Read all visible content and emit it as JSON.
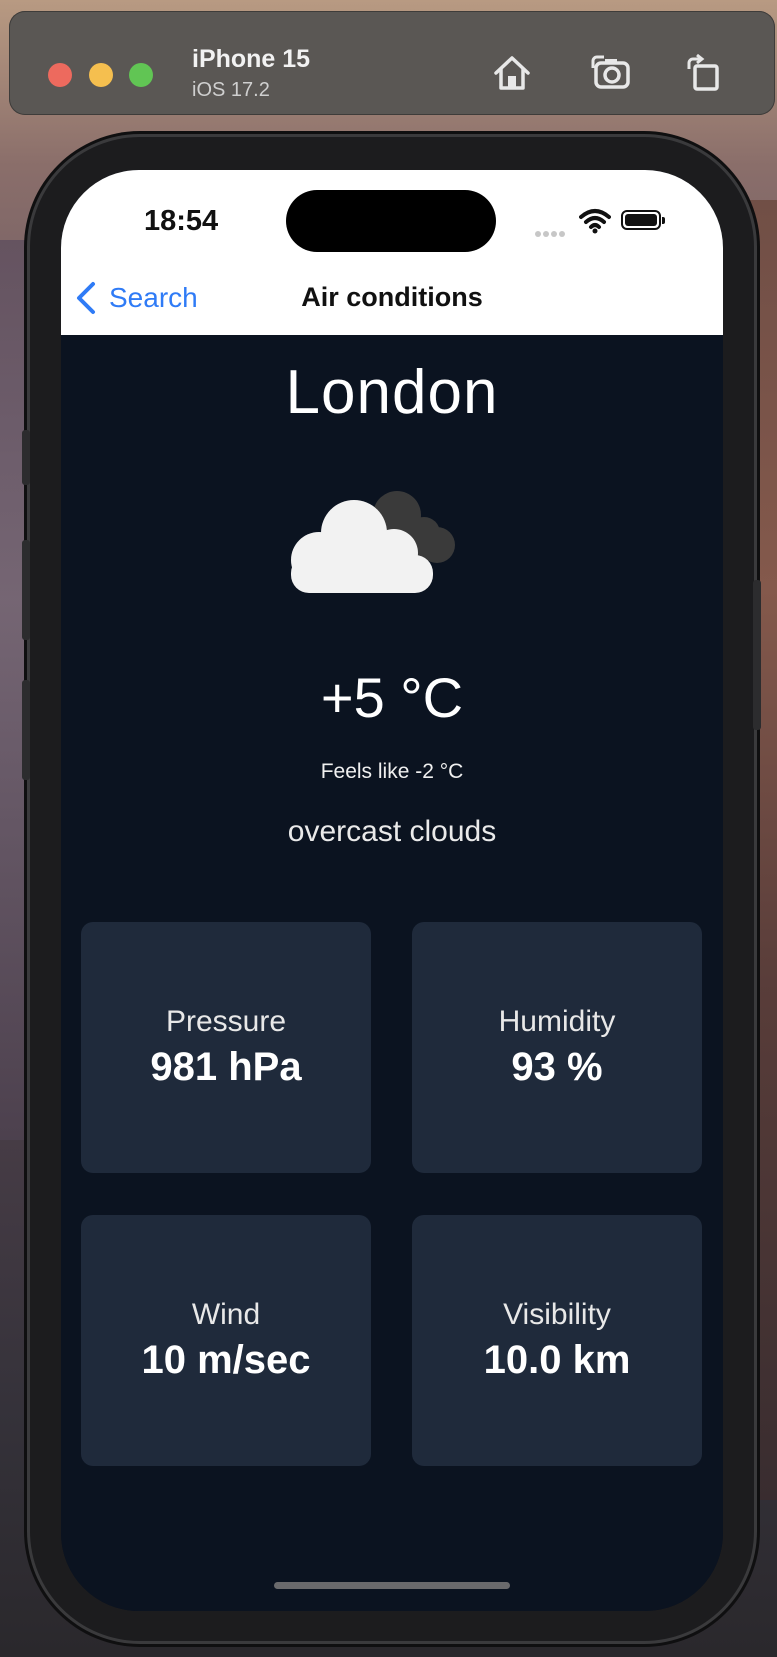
{
  "simulator": {
    "device_name": "iPhone 15",
    "os_version": "iOS 17.2",
    "toolbar_icons": [
      "home-icon",
      "screenshot-camera-icon",
      "rotate-icon"
    ]
  },
  "status_bar": {
    "time": "18:54",
    "icons": [
      "cellular-signal-icon",
      "wifi-icon",
      "battery-icon"
    ]
  },
  "nav_bar": {
    "back_label": "Search",
    "title": "Air conditions"
  },
  "weather": {
    "city": "London",
    "icon": "overcast-clouds-icon",
    "temperature": "+5 °C",
    "feels_like": "Feels like -2 °C",
    "description": "overcast clouds"
  },
  "cards": [
    {
      "label": "Pressure",
      "value": "981 hPa"
    },
    {
      "label": "Humidity",
      "value": "93 %"
    },
    {
      "label": "Wind",
      "value": "10 m/sec"
    },
    {
      "label": "Visibility",
      "value": "10.0 km"
    }
  ],
  "colors": {
    "screen_bg": "#0b1320",
    "card_bg": "#1f2a3b",
    "accent_blue": "#2f7bf6",
    "text_primary": "#ffffff"
  }
}
